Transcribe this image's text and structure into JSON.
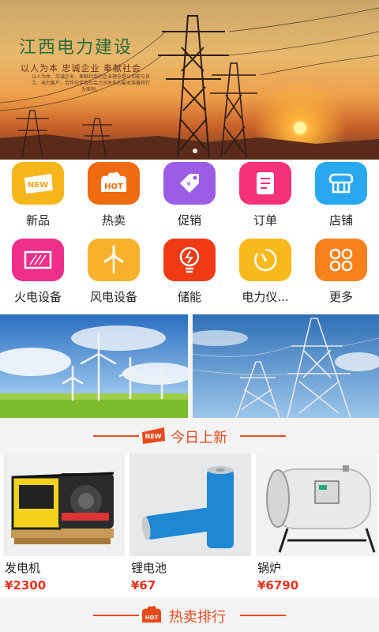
{
  "banner": {
    "title": "江西电力建设",
    "slogan": "以人为本  忠诚企业  奉献社会",
    "small_text": "以人为本，忠诚企业，奉献社会的企业理念是公司能与员工、电力客户、合作伙伴及社会之间关系的最本准备和行为准则。"
  },
  "categories": [
    {
      "label": "新品",
      "icon": "new-badge-icon",
      "color": "#f7b51c"
    },
    {
      "label": "热卖",
      "icon": "hot-badge-icon",
      "color": "#f06a12"
    },
    {
      "label": "促销",
      "icon": "price-tag-icon",
      "color": "#9b5de5"
    },
    {
      "label": "订单",
      "icon": "order-list-icon",
      "color": "#f5327a"
    },
    {
      "label": "店铺",
      "icon": "store-icon",
      "color": "#29a8f0"
    },
    {
      "label": "火电设备",
      "icon": "thermal-power-icon",
      "color": "#f02e8c"
    },
    {
      "label": "风电设备",
      "icon": "wind-turbine-icon",
      "color": "#f8b12c"
    },
    {
      "label": "储能",
      "icon": "energy-storage-icon",
      "color": "#f03a14"
    },
    {
      "label": "电力仪...",
      "icon": "meter-icon",
      "color": "#f8b91c"
    },
    {
      "label": "更多",
      "icon": "more-grid-icon",
      "color": "#f7821c"
    }
  ],
  "section_new": {
    "title": "今日上新",
    "badge": "NEW"
  },
  "products": [
    {
      "name": "发电机",
      "price": "¥2300"
    },
    {
      "name": "锂电池",
      "price": "¥67"
    },
    {
      "name": "锅炉",
      "price": "¥6790"
    }
  ],
  "section_hot": {
    "title": "热卖排行",
    "badge": "HOT"
  },
  "colors": {
    "accent": "#e84a1c",
    "price": "#e8331c"
  }
}
